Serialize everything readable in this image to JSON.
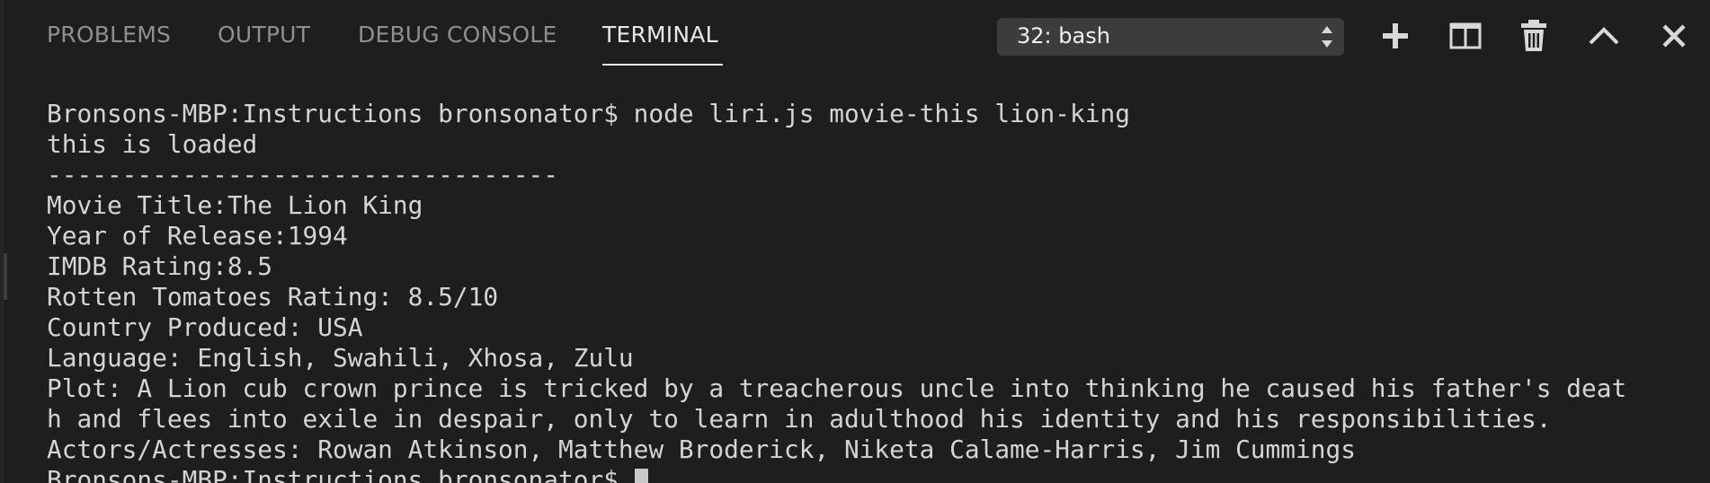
{
  "tabs": [
    {
      "label": "PROBLEMS"
    },
    {
      "label": "OUTPUT"
    },
    {
      "label": "DEBUG CONSOLE"
    },
    {
      "label": "TERMINAL",
      "active": true
    }
  ],
  "terminal_select": {
    "value": "32: bash"
  },
  "actions": [
    {
      "icon": "plus-icon",
      "title": "New Terminal"
    },
    {
      "icon": "split-icon",
      "title": "Split Terminal"
    },
    {
      "icon": "trash-icon",
      "title": "Kill Terminal"
    },
    {
      "icon": "chevron-up-icon",
      "title": "Maximize Panel"
    },
    {
      "icon": "close-icon",
      "title": "Close Panel"
    }
  ],
  "colors": {
    "background": "#1e1e1e",
    "tab_inactive": "#8f8f8f",
    "tab_active": "#e7e7e7",
    "text": "#d4d4d4",
    "select_bg": "#3c3c3c"
  },
  "terminal": {
    "lines": [
      "Bronsons-MBP:Instructions bronsonator$ node liri.js movie-this lion-king",
      "this is loaded",
      "----------------------------------",
      "Movie Title:The Lion King",
      "Year of Release:1994",
      "IMDB Rating:8.5",
      "Rotten Tomatoes Rating: 8.5/10",
      "Country Produced: USA",
      "Language: English, Swahili, Xhosa, Zulu",
      "Plot: A Lion cub crown prince is tricked by a treacherous uncle into thinking he caused his father's deat",
      "h and flees into exile in despair, only to learn in adulthood his identity and his responsibilities.",
      "Actors/Actresses: Rowan Atkinson, Matthew Broderick, Niketa Calame-Harris, Jim Cummings"
    ],
    "prompt": "Bronsons-MBP:Instructions bronsonator$ "
  }
}
